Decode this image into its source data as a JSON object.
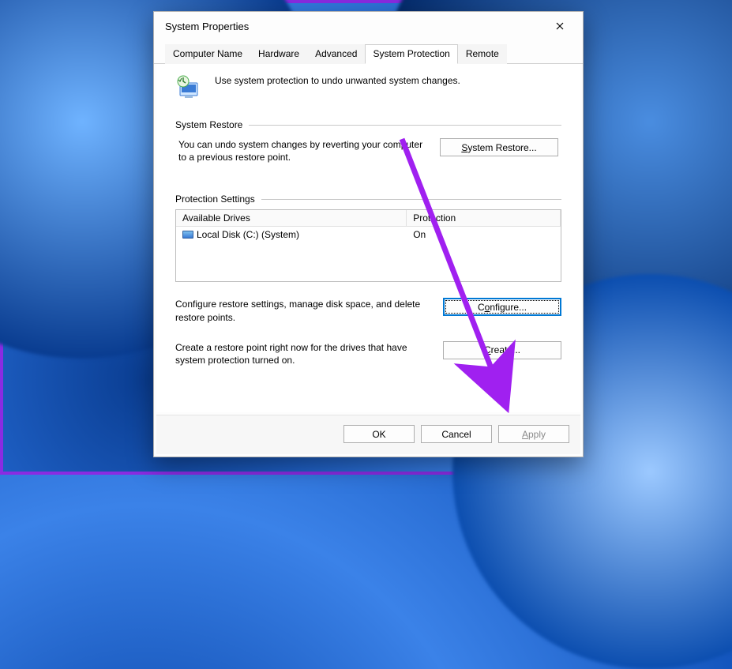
{
  "dialog": {
    "title": "System Properties",
    "tabs": [
      "Computer Name",
      "Hardware",
      "Advanced",
      "System Protection",
      "Remote"
    ],
    "active_tab": "System Protection",
    "intro": "Use system protection to undo unwanted system changes.",
    "restore": {
      "group_label": "System Restore",
      "text": "You can undo system changes by reverting your computer to a previous restore point.",
      "button": "System Restore..."
    },
    "protection": {
      "group_label": "Protection Settings",
      "table": {
        "headers": [
          "Available Drives",
          "Protection"
        ],
        "rows": [
          {
            "drive": "Local Disk (C:) (System)",
            "protection": "On"
          }
        ]
      },
      "configure_text": "Configure restore settings, manage disk space, and delete restore points.",
      "configure_button": "Configure...",
      "create_text": "Create a restore point right now for the drives that have system protection turned on.",
      "create_button": "Create..."
    },
    "buttons": {
      "ok": "OK",
      "cancel": "Cancel",
      "apply": "Apply"
    }
  },
  "annotation": {
    "color": "#a020f0"
  }
}
